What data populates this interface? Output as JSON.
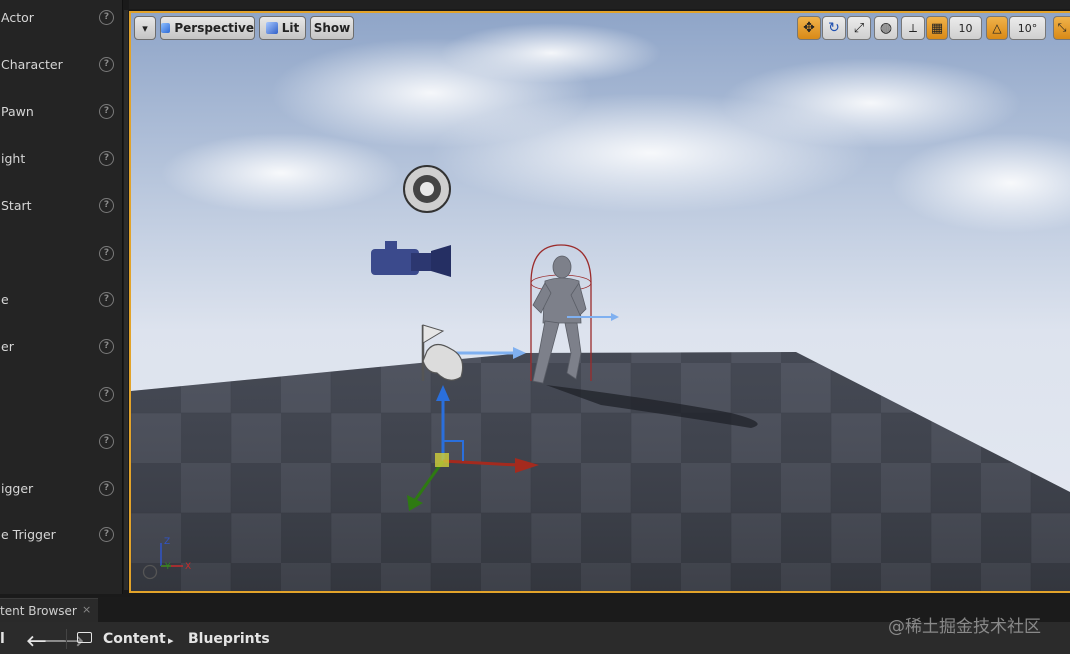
{
  "left_panel": {
    "items": [
      {
        "label": "Actor"
      },
      {
        "label": "Character"
      },
      {
        "label": "Pawn"
      },
      {
        "label": "ight"
      },
      {
        "label": " Start"
      },
      {
        "label": ""
      },
      {
        "label": "e"
      },
      {
        "label": "er"
      },
      {
        "label": ""
      },
      {
        "label": ""
      },
      {
        "label": "igger"
      },
      {
        "label": "e Trigger"
      }
    ],
    "help_glyph": "?"
  },
  "viewport_toolbar": {
    "menu_arrow": "▾",
    "perspective_label": "Perspective",
    "lit_label": "Lit",
    "show_label": "Show",
    "grid_snap_value": "10",
    "rotation_snap_value": "10°"
  },
  "axis_widget": {
    "z": "Z",
    "y": "Y",
    "x": "X"
  },
  "content_browser": {
    "tab_label": "tent Browser",
    "tab_close": "×",
    "nav_left": "l",
    "back_arrow": "🡐",
    "forward_arrow": "🡒",
    "path": [
      "Content",
      "Blueprints"
    ],
    "path_separator": "▸"
  },
  "watermark": "@稀土掘金技术社区",
  "colors": {
    "selection_border": "#e2a32a",
    "toolbar_active": "#e09a26",
    "gizmo_x": "#c0281c",
    "gizmo_y": "#2e7a12",
    "gizmo_z": "#2a6fdc"
  }
}
